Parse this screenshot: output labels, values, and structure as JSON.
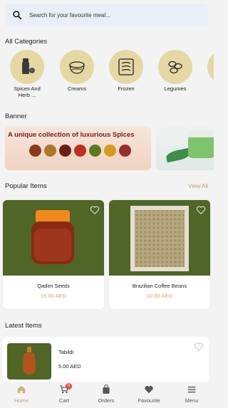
{
  "search": {
    "placeholder": "Search for your favourite meal..."
  },
  "categories": {
    "title": "All Categories",
    "items": [
      {
        "label": "Spices And Herb ...",
        "icon": "spice-grinder-icon"
      },
      {
        "label": "Creams",
        "icon": "cream-bowl-icon"
      },
      {
        "label": "Frozen",
        "icon": "frozen-food-icon"
      },
      {
        "label": "Legumes",
        "icon": "legumes-icon"
      }
    ]
  },
  "banner": {
    "title": "Banner",
    "slides": [
      {
        "text": "A unique collection of luxurious Spices"
      }
    ]
  },
  "popular": {
    "title": "Popular Items",
    "view_all": "View All",
    "items": [
      {
        "name": "Qadim Seeds",
        "price": "15.00 AED"
      },
      {
        "name": "Brazilian Coffee Beans",
        "price": "10.00 AED"
      }
    ]
  },
  "latest": {
    "title": "Latest Items",
    "items": [
      {
        "name": "Tabildi",
        "price": "5.00 AED"
      }
    ]
  },
  "nav": {
    "items": [
      {
        "label": "Home",
        "icon": "home-icon",
        "active": true
      },
      {
        "label": "Cart",
        "icon": "cart-icon",
        "badge": "0"
      },
      {
        "label": "Orders",
        "icon": "orders-bag-icon"
      },
      {
        "label": "Favourite",
        "icon": "heart-icon"
      },
      {
        "label": "Menu",
        "icon": "menu-icon"
      }
    ]
  },
  "colors": {
    "accent": "#b9a76a",
    "category_bg": "#e5d8a2",
    "product_bg": "#4f6626",
    "badge": "#e54b3f"
  }
}
